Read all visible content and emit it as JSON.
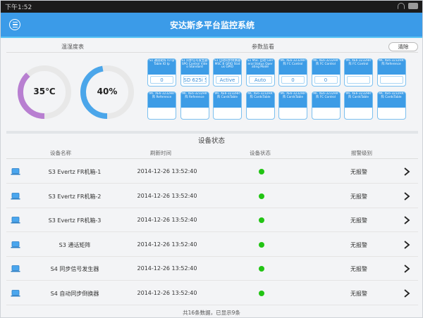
{
  "status_bar": {
    "time": "下午1:52",
    "icons": [
      "wifi-icon",
      "battery-icon"
    ]
  },
  "header": {
    "title": "安达斯多平台监控系统",
    "menu_icon": "menu-icon",
    "bg_color": "#3b9be8"
  },
  "tabs": {
    "temperature": "温湿度表",
    "params": "参数监看",
    "clear_button": "清除"
  },
  "gauges": [
    {
      "label": "35℃",
      "value": 35,
      "fill": 0.38,
      "color": "#b87fd1"
    },
    {
      "label": "40%",
      "value": 40,
      "fill": 0.47,
      "color": "#4ba6ea"
    }
  ],
  "params": [
    {
      "title": "S1 通道矩阵 IO IpTable IO Ip",
      "value": "0"
    },
    {
      "title": "S1 同步信号发生器 SPG Control Video Standard",
      "value": "SD 625i 50"
    },
    {
      "title": "S1 自动同步倒换器 MSC B GPIO Status GPIO",
      "value": "Active"
    },
    {
      "title": "S1 MSC 自动 General Status Operating Mode",
      "value": "Auto"
    },
    {
      "title": "MC XE6-3232HR阵 FC Control",
      "value": "0"
    },
    {
      "title": "MC XE6-3232HR阵 FC Control",
      "value": "0"
    },
    {
      "title": "MC XE6-3232HR阵 FC Control",
      "value": ""
    },
    {
      "title": "MC XE6-3232HR阵 Reference",
      "value": ""
    },
    {
      "title": "MC XE6-3232HR阵 Reference",
      "value": ""
    },
    {
      "title": "MC XE6-3232HR阵 Reference",
      "value": ""
    },
    {
      "title": "MC XE6-3232HR阵 CardsTable",
      "value": ""
    },
    {
      "title": "MC XE6-3232HR阵 CardsTable",
      "value": ""
    },
    {
      "title": "MC XE6-3232HR阵 CardsTable",
      "value": ""
    },
    {
      "title": "MC XE6-3232HR阵 FC Control",
      "value": ""
    },
    {
      "title": "MC XE6-3232HR阵 CardsTable",
      "value": ""
    },
    {
      "title": "MC XE6-3232HR阵 CardsTable",
      "value": ""
    }
  ],
  "devices": {
    "section_title": "设备状态",
    "columns": [
      "设备名称",
      "刷新时间",
      "设备状态",
      "报警级别"
    ],
    "status_color": "#22c414",
    "rows": [
      {
        "name": "S3 Evertz FR机箱-1",
        "time": "2014-12-26 13:52:40",
        "alarm": "无报警"
      },
      {
        "name": "S3 Evertz FR机箱-2",
        "time": "2014-12-26 13:52:40",
        "alarm": "无报警"
      },
      {
        "name": "S3 Evertz FR机箱-3",
        "time": "2014-12-26 13:52:40",
        "alarm": "无报警"
      },
      {
        "name": "S3 通话矩阵",
        "time": "2014-12-26 13:52:40",
        "alarm": "无报警"
      },
      {
        "name": "S4 同步信号发生器",
        "time": "2014-12-26 13:52:40",
        "alarm": "无报警"
      },
      {
        "name": "S4 自动同步倒换器",
        "time": "2014-12-26 13:52:40",
        "alarm": "无报警"
      }
    ]
  },
  "footer": {
    "text": "共16条数据，已显示9条"
  }
}
